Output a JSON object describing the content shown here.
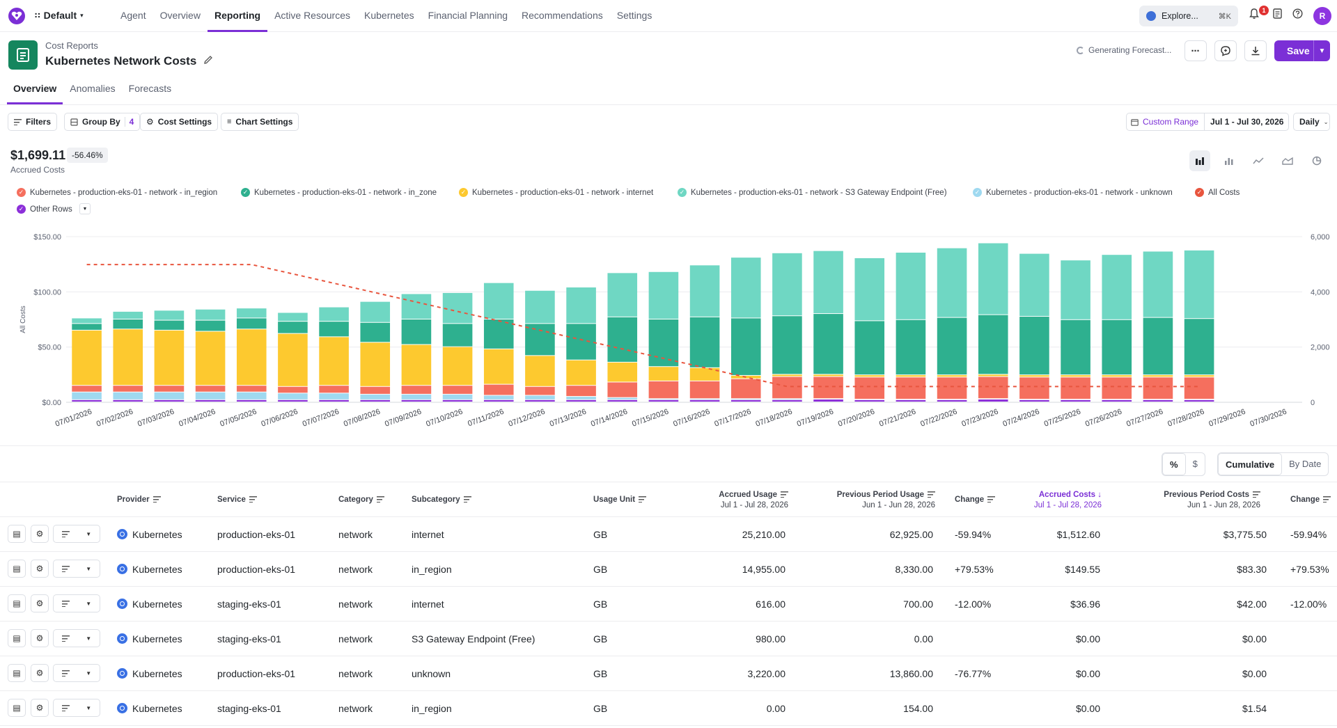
{
  "nav": {
    "workspace": "Default",
    "items": [
      {
        "label": "Agent",
        "active": false
      },
      {
        "label": "Overview",
        "active": false
      },
      {
        "label": "Reporting",
        "active": true
      },
      {
        "label": "Active Resources",
        "active": false
      },
      {
        "label": "Kubernetes",
        "active": false
      },
      {
        "label": "Financial Planning",
        "active": false
      },
      {
        "label": "Recommendations",
        "active": false
      },
      {
        "label": "Settings",
        "active": false
      }
    ],
    "explore_label": "Explore...",
    "explore_shortcut": "⌘K",
    "notification_count": "1",
    "avatar_initial": "R"
  },
  "header": {
    "breadcrumb": "Cost Reports",
    "title": "Kubernetes Network Costs",
    "status": "Generating Forecast...",
    "save_label": "Save"
  },
  "tabs": [
    {
      "label": "Overview",
      "active": true
    },
    {
      "label": "Anomalies",
      "active": false
    },
    {
      "label": "Forecasts",
      "active": false
    }
  ],
  "toolbar": {
    "filters": "Filters",
    "group_by": "Group By",
    "group_by_count": "4",
    "cost_settings": "Cost Settings",
    "chart_settings": "Chart Settings",
    "custom_range": "Custom Range",
    "date_range": "Jul 1 - Jul 30, 2026",
    "granularity": "Daily"
  },
  "summary": {
    "total": "$1,699.11",
    "change": "-56.46%",
    "label": "Accrued Costs"
  },
  "colors": {
    "accent": "#7b2fd6",
    "in_region": "#f56f5e",
    "in_zone": "#2eb08f",
    "internet": "#fdc92f",
    "s3": "#6fd7c3",
    "unknown": "#9fd9f0",
    "all_costs": "#e8553e",
    "other": "#8c2fd9"
  },
  "legend": [
    {
      "label": "Kubernetes - production-eks-01 - network - in_region",
      "color": "#f56f5e"
    },
    {
      "label": "Kubernetes - production-eks-01 - network - in_zone",
      "color": "#2eb08f"
    },
    {
      "label": "Kubernetes - production-eks-01 - network - internet",
      "color": "#fdc92f"
    },
    {
      "label": "Kubernetes - production-eks-01 - network - S3 Gateway Endpoint (Free)",
      "color": "#6fd7c3"
    },
    {
      "label": "Kubernetes - production-eks-01 - network - unknown",
      "color": "#9fd9f0"
    },
    {
      "label": "All Costs",
      "color": "#e8553e"
    },
    {
      "label": "Other Rows",
      "color": "#8c2fd9"
    }
  ],
  "chart_data": {
    "type": "bar",
    "stacked": true,
    "ylabel": "All Costs",
    "ylim": [
      0,
      150
    ],
    "yticks": [
      "$0.00",
      "$50.00",
      "$100.00",
      "$150.00"
    ],
    "y2lim": [
      0,
      6000
    ],
    "y2ticks": [
      "0",
      "2,000",
      "4,000",
      "6,000"
    ],
    "categories": [
      "07/01/2026",
      "07/02/2026",
      "07/03/2026",
      "07/04/2026",
      "07/05/2026",
      "07/06/2026",
      "07/07/2026",
      "07/08/2026",
      "07/09/2026",
      "07/10/2026",
      "07/11/2026",
      "07/12/2026",
      "07/13/2026",
      "07/14/2026",
      "07/15/2026",
      "07/16/2026",
      "07/17/2026",
      "07/18/2026",
      "07/19/2026",
      "07/20/2026",
      "07/21/2026",
      "07/22/2026",
      "07/23/2026",
      "07/24/2026",
      "07/25/2026",
      "07/26/2026",
      "07/27/2026",
      "07/28/2026",
      "07/29/2026",
      "07/30/2026"
    ],
    "series": [
      {
        "name": "Other Rows",
        "color": "#8c2fd9",
        "values": [
          2,
          2,
          2,
          2,
          2,
          2,
          2,
          2,
          2,
          2,
          2,
          2,
          2,
          2,
          2,
          2,
          2,
          2,
          2.5,
          2,
          2,
          2,
          2.5,
          2,
          2,
          2,
          2,
          2
        ]
      },
      {
        "name": "Kubernetes - production-eks-01 - network - unknown",
        "color": "#9fd9f0",
        "values": [
          7,
          7,
          7,
          7,
          7,
          6,
          6,
          5,
          5,
          5,
          4,
          4,
          3,
          2,
          1,
          1,
          1,
          1,
          0.5,
          0.5,
          0.5,
          0.5,
          0.5,
          0.5,
          0.5,
          0.5,
          0.5,
          0.5
        ]
      },
      {
        "name": "Kubernetes - production-eks-01 - network - in_region",
        "color": "#f56f5e",
        "values": [
          6,
          6,
          6,
          6,
          6,
          6,
          7,
          7,
          8,
          8,
          10,
          8,
          10,
          14,
          16,
          16,
          18,
          20,
          20,
          20,
          20,
          20,
          20,
          20,
          20,
          20,
          20,
          20
        ]
      },
      {
        "name": "Kubernetes - production-eks-01 - network - internet",
        "color": "#fdc92f",
        "values": [
          50,
          51,
          50,
          49,
          51,
          48,
          44,
          40,
          37,
          35,
          32,
          28,
          23,
          18,
          13,
          12,
          3,
          2,
          2,
          2,
          2,
          2,
          2,
          2,
          2,
          2,
          2,
          2
        ]
      },
      {
        "name": "Kubernetes - production-eks-01 - network - in_zone",
        "color": "#2eb08f",
        "values": [
          6,
          9,
          9,
          10,
          10,
          11,
          14,
          18,
          23,
          21,
          27,
          29,
          33,
          41,
          43,
          46,
          52,
          53,
          55,
          49,
          50,
          52,
          54,
          53,
          50,
          50,
          52,
          51
        ]
      },
      {
        "name": "Kubernetes - production-eks-01 - network - S3 Gateway Endpoint (Free)",
        "color": "#6fd7c3",
        "values": [
          5,
          7,
          9,
          10,
          9,
          8,
          13,
          19,
          23,
          28,
          33,
          30,
          33,
          40,
          43,
          47,
          55,
          57,
          57,
          57,
          61,
          63,
          65,
          57,
          54,
          59,
          60,
          62
        ]
      }
    ],
    "line": {
      "name": "All Costs",
      "color": "#e8553e",
      "axis": "right",
      "values": [
        4990,
        4990,
        4990,
        4990,
        4990,
        4650,
        4310,
        3970,
        3630,
        3290,
        2950,
        2610,
        2270,
        1930,
        1590,
        1250,
        910,
        570,
        570,
        570,
        570,
        570,
        570,
        570,
        570,
        570,
        570,
        570
      ]
    }
  },
  "table": {
    "toggle_pct": "%",
    "toggle_dollar": "$",
    "toggle_cumulative": "Cumulative",
    "toggle_by_date": "By Date",
    "headers": {
      "provider": "Provider",
      "service": "Service",
      "category": "Category",
      "subcategory": "Subcategory",
      "usage_unit": "Usage Unit",
      "accrued_usage": "Accrued Usage",
      "accrued_usage_range": "Jul 1 - Jul 28, 2026",
      "prev_usage": "Previous Period Usage",
      "prev_usage_range": "Jun 1 - Jun 28, 2026",
      "change": "Change",
      "accrued_costs": "Accrued Costs",
      "accrued_costs_range": "Jul 1 - Jul 28, 2026",
      "prev_costs": "Previous Period Costs",
      "prev_costs_range": "Jun 1 - Jun 28, 2026",
      "change2": "Change"
    },
    "rows": [
      {
        "provider": "Kubernetes",
        "service": "production-eks-01",
        "category": "network",
        "subcategory": "internet",
        "unit": "GB",
        "accrued_usage": "25,210.00",
        "prev_usage": "62,925.00",
        "change": "-59.94%",
        "accrued_costs": "$1,512.60",
        "prev_costs": "$3,775.50",
        "change2": "-59.94%"
      },
      {
        "provider": "Kubernetes",
        "service": "production-eks-01",
        "category": "network",
        "subcategory": "in_region",
        "unit": "GB",
        "accrued_usage": "14,955.00",
        "prev_usage": "8,330.00",
        "change": "+79.53%",
        "accrued_costs": "$149.55",
        "prev_costs": "$83.30",
        "change2": "+79.53%"
      },
      {
        "provider": "Kubernetes",
        "service": "staging-eks-01",
        "category": "network",
        "subcategory": "internet",
        "unit": "GB",
        "accrued_usage": "616.00",
        "prev_usage": "700.00",
        "change": "-12.00%",
        "accrued_costs": "$36.96",
        "prev_costs": "$42.00",
        "change2": "-12.00%"
      },
      {
        "provider": "Kubernetes",
        "service": "staging-eks-01",
        "category": "network",
        "subcategory": "S3 Gateway Endpoint (Free)",
        "unit": "GB",
        "accrued_usage": "980.00",
        "prev_usage": "0.00",
        "change": "",
        "accrued_costs": "$0.00",
        "prev_costs": "$0.00",
        "change2": ""
      },
      {
        "provider": "Kubernetes",
        "service": "production-eks-01",
        "category": "network",
        "subcategory": "unknown",
        "unit": "GB",
        "accrued_usage": "3,220.00",
        "prev_usage": "13,860.00",
        "change": "-76.77%",
        "accrued_costs": "$0.00",
        "prev_costs": "$0.00",
        "change2": ""
      },
      {
        "provider": "Kubernetes",
        "service": "staging-eks-01",
        "category": "network",
        "subcategory": "in_region",
        "unit": "GB",
        "accrued_usage": "0.00",
        "prev_usage": "154.00",
        "change": "",
        "accrued_costs": "$0.00",
        "prev_costs": "$1.54",
        "change2": ""
      }
    ]
  }
}
